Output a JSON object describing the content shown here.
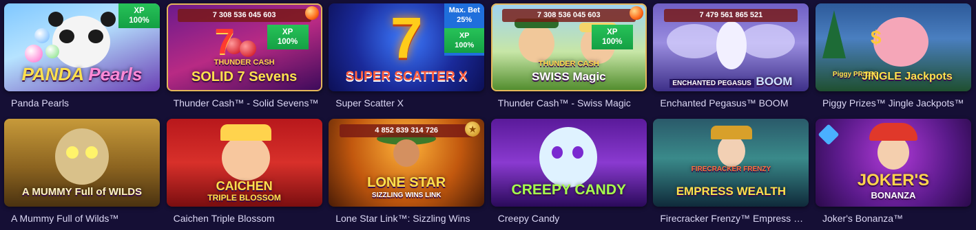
{
  "games": [
    {
      "title": "Panda Pearls",
      "logo_a": "PANDA",
      "logo_b": "Pearls",
      "badge": {
        "label": "XP",
        "value": "100%"
      }
    },
    {
      "title": "Thunder Cash™ - Solid Sevens™",
      "jackpot": "7 308 536 045 603",
      "logo_top": "THUNDER CASH",
      "logo_main": "SOLID 7 Sevens",
      "badge": {
        "label": "XP",
        "value": "100%"
      }
    },
    {
      "title": "Super Scatter X",
      "logo_main": "SUPER SCATTER X",
      "logo_big": "7",
      "badge": {
        "maxbet_label": "Max. Bet",
        "maxbet_value": "25%",
        "label": "XP",
        "value": "100%"
      }
    },
    {
      "title": "Thunder Cash™ - Swiss Magic",
      "jackpot": "7 308 536 045 603",
      "logo_top": "THUNDER CASH",
      "logo_main": "SWISS Magic",
      "badge": {
        "label": "XP",
        "value": "100%"
      }
    },
    {
      "title": "Enchanted Pegasus™ BOOM",
      "jackpot": "7 479 561 865 521",
      "logo_main": "ENCHANTED PEGASUS",
      "logo_b": "BOOM"
    },
    {
      "title": "Piggy Prizes™ Jingle Jackpots™",
      "logo_main": "JINGLE Jackpots",
      "logo_small": "Piggy PRIZES"
    },
    {
      "title": "A Mummy Full of Wilds™",
      "logo_main": "A MUMMY Full of WILDS"
    },
    {
      "title": "Caichen Triple Blossom",
      "logo_main": "CAICHEN",
      "logo_b": "TRIPLE BLOSSOM"
    },
    {
      "title": "Lone Star Link™: Sizzling Wins",
      "jackpot": "4 852 839 314 726",
      "logo_main": "LONE STAR",
      "logo_b": "SIZZLING WINS LINK",
      "star": "★"
    },
    {
      "title": "Creepy Candy",
      "logo_main": "CREEPY CANDY"
    },
    {
      "title": "Firecracker Frenzy™ Empress Wealth",
      "logo_top": "FIRECRACKER FRENZY",
      "logo_main": "EMPRESS WEALTH"
    },
    {
      "title": "Joker's Bonanza™",
      "logo_main": "JOKER'S",
      "logo_b": "BONANZA"
    }
  ],
  "colors": {
    "background": "#150f35",
    "xp_badge": "#1ea84c",
    "maxbet_badge": "#1f6fdc",
    "jackpot_bar": "#781914",
    "title_text": "#dcd8f5"
  }
}
